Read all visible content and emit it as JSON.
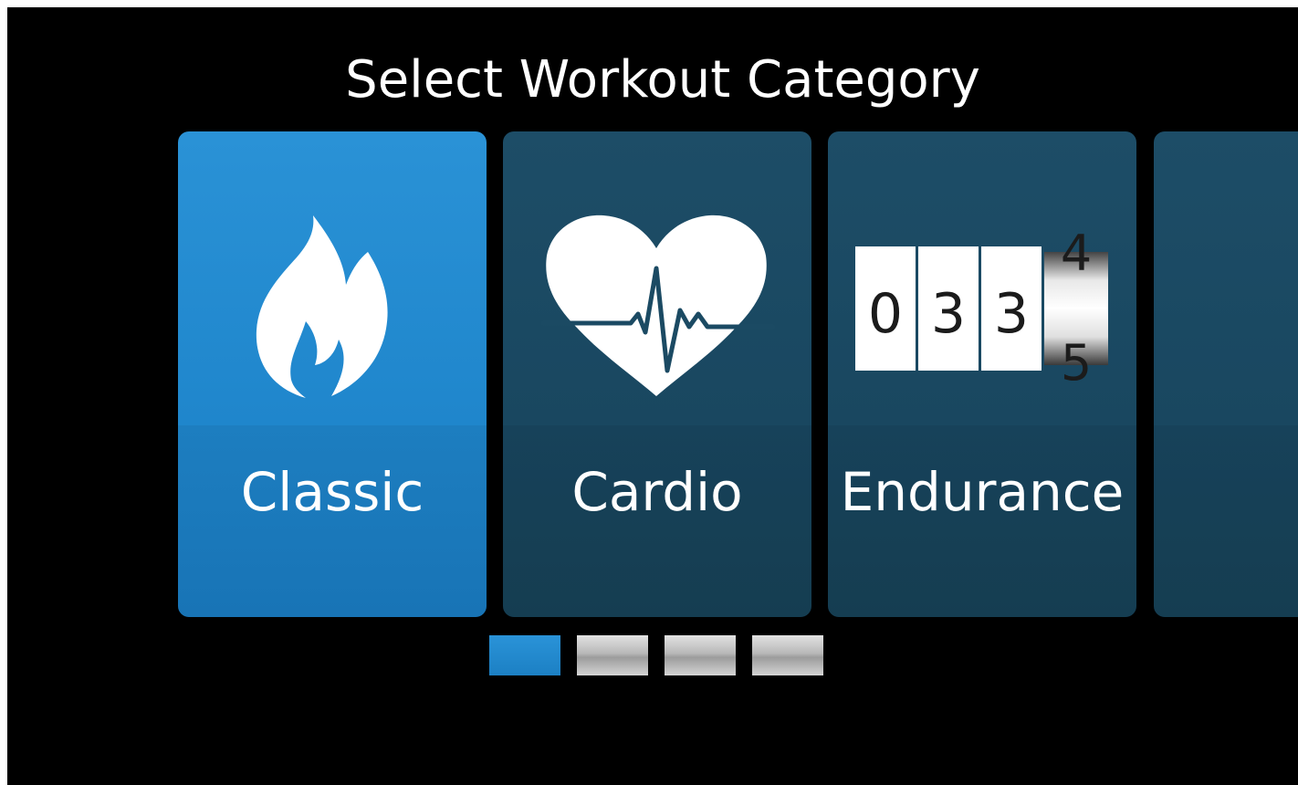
{
  "header": {
    "title": "Select Workout Category"
  },
  "categories": [
    {
      "label": "Classic",
      "icon": "flame-icon",
      "selected": true
    },
    {
      "label": "Cardio",
      "icon": "heart-pulse-icon",
      "selected": false
    },
    {
      "label": "Endurance",
      "icon": "odometer-icon",
      "selected": false,
      "odometer_digits": [
        "0",
        "3",
        "3"
      ],
      "odometer_rolling": [
        "4",
        "5"
      ]
    }
  ],
  "pagination": {
    "pages": 4,
    "active_index": 0
  },
  "colors": {
    "background": "#000000",
    "selected_card": "#2288cf",
    "card": "#1b4a63",
    "active_indicator": "#2286cf",
    "inactive_indicator": "#bfbfbf",
    "text": "#ffffff"
  }
}
